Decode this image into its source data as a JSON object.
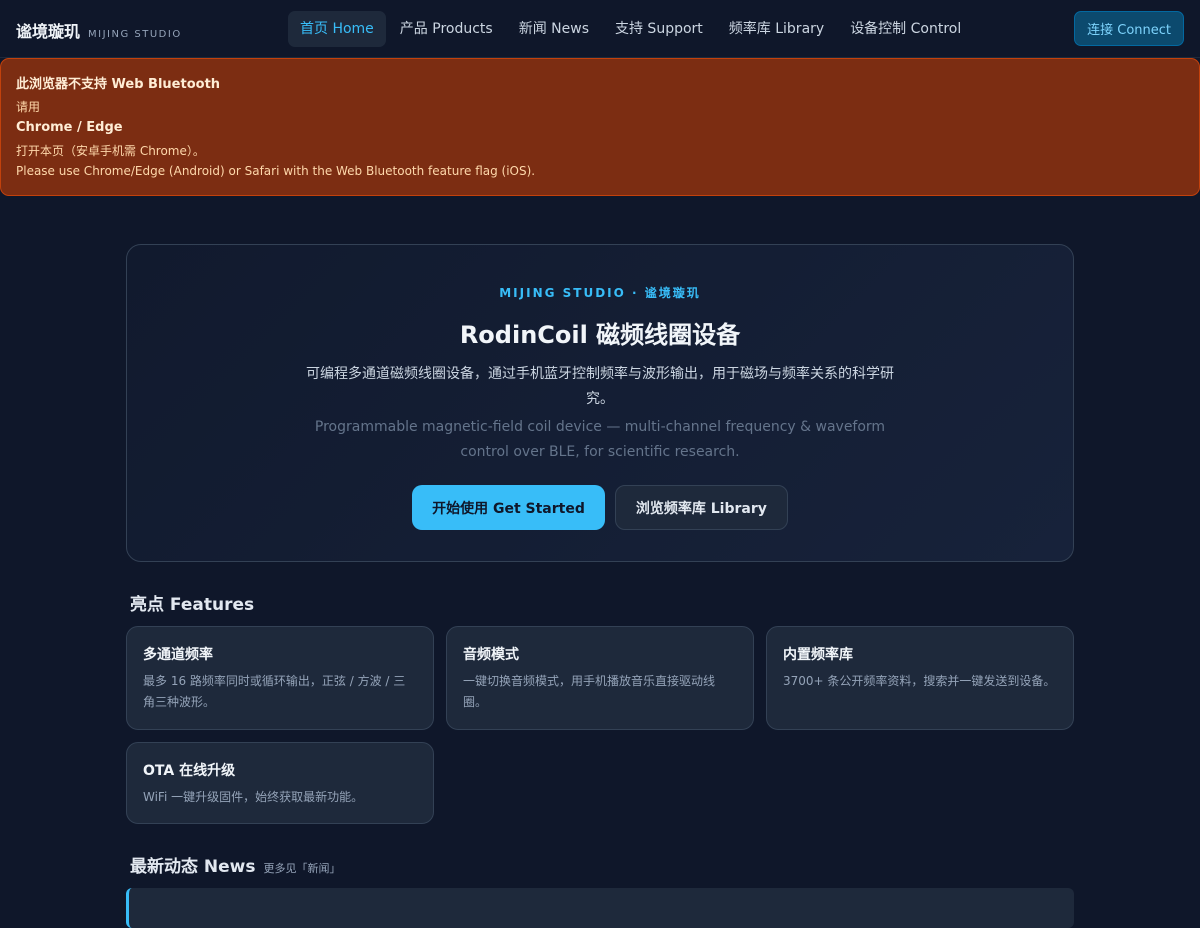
{
  "brand": {
    "name_cn": "谧境璇玑",
    "name_en": "MIJING STUDIO"
  },
  "nav": {
    "items": [
      {
        "label": "首页 Home",
        "active": true
      },
      {
        "label": "产品 Products",
        "active": false
      },
      {
        "label": "新闻 News",
        "active": false
      },
      {
        "label": "支持 Support",
        "active": false
      },
      {
        "label": "频率库 Library",
        "active": false
      },
      {
        "label": "设备控制 Control",
        "active": false
      }
    ],
    "connect_label": "连接 Connect"
  },
  "warning": {
    "title": "此浏览器不支持 Web Bluetooth",
    "line1": "请用",
    "browsers": "Chrome / Edge",
    "line2": "打开本页（安卓手机需 Chrome）。",
    "line3": "Please use Chrome/Edge (Android) or Safari with the Web Bluetooth feature flag (iOS)."
  },
  "hero": {
    "eyebrow": "MIJING STUDIO · 谧境璇玑",
    "title": "RodinCoil 磁频线圈设备",
    "desc_cn": "可编程多通道磁频线圈设备，通过手机蓝牙控制频率与波形输出，用于磁场与频率关系的科学研究。",
    "desc_en": "Programmable magnetic-field coil device — multi-channel frequency & waveform control over BLE, for scientific research.",
    "primary_label": "开始使用 Get Started",
    "secondary_label": "浏览频率库 Library"
  },
  "features": {
    "title": "亮点 Features",
    "items": [
      {
        "title": "多通道频率",
        "desc": "最多 16 路频率同时或循环输出，正弦 / 方波 / 三角三种波形。"
      },
      {
        "title": "音频模式",
        "desc": "一键切换音频模式，用手机播放音乐直接驱动线圈。"
      },
      {
        "title": "内置频率库",
        "desc": "3700+ 条公开频率资料，搜索并一键发送到设备。"
      },
      {
        "title": "OTA 在线升级",
        "desc": "WiFi 一键升级固件，始终获取最新功能。"
      }
    ]
  },
  "news": {
    "title": "最新动态 News",
    "more": "更多见「新闻」"
  },
  "colors": {
    "background": "#0f172a",
    "accent": "#38bdf8",
    "warning_bg": "#7c2d12",
    "card_bg": "#1e293b"
  }
}
